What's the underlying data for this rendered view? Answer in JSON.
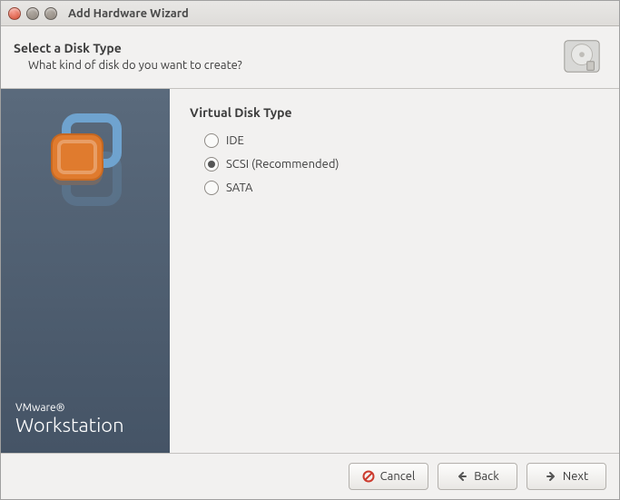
{
  "window": {
    "title": "Add Hardware Wizard"
  },
  "header": {
    "title": "Select a Disk Type",
    "subtitle": "What kind of disk do you want to create?"
  },
  "sidebar": {
    "brand_small": "VMware®",
    "brand_big": "Workstation"
  },
  "main": {
    "section_title": "Virtual Disk Type",
    "options": [
      {
        "label": "IDE",
        "selected": false
      },
      {
        "label": "SCSI (Recommended)",
        "selected": true
      },
      {
        "label": "SATA",
        "selected": false
      }
    ]
  },
  "buttons": {
    "cancel": "Cancel",
    "back": "Back",
    "next": "Next"
  }
}
